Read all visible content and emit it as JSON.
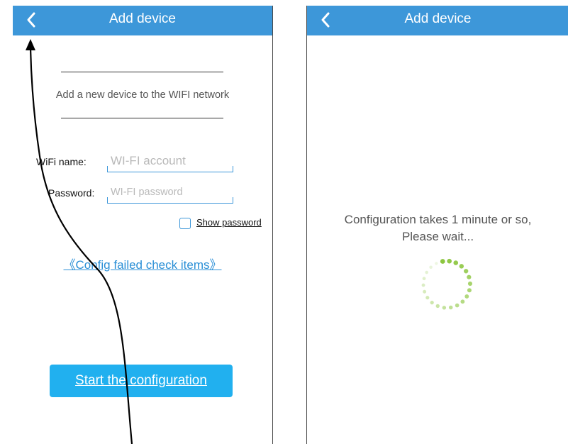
{
  "left_screen": {
    "title": "Add device",
    "intro": "Add a new device to the WIFI network",
    "wifi_label": "WiFi name:",
    "wifi_placeholder": "WI-FI account",
    "wifi_value": "",
    "password_label": "Password:",
    "password_placeholder": "WI-FI password",
    "password_value": "",
    "show_password_label": "Show password",
    "show_password_checked": false,
    "check_items_link": "《Config failed check items》",
    "start_button": "Start the configuration"
  },
  "right_screen": {
    "title": "Add device",
    "wait_line1": "Configuration takes 1 minute or so,",
    "wait_line2": "Please wait..."
  },
  "icons": {
    "back": "chevron-left-icon",
    "spinner": "loading-spinner-icon",
    "annotation": "arrow-annotation"
  },
  "colors": {
    "titlebar": "#3d97d9",
    "button": "#21b0ef",
    "link": "#2a8fd6",
    "spinner": "#8cc63f"
  }
}
